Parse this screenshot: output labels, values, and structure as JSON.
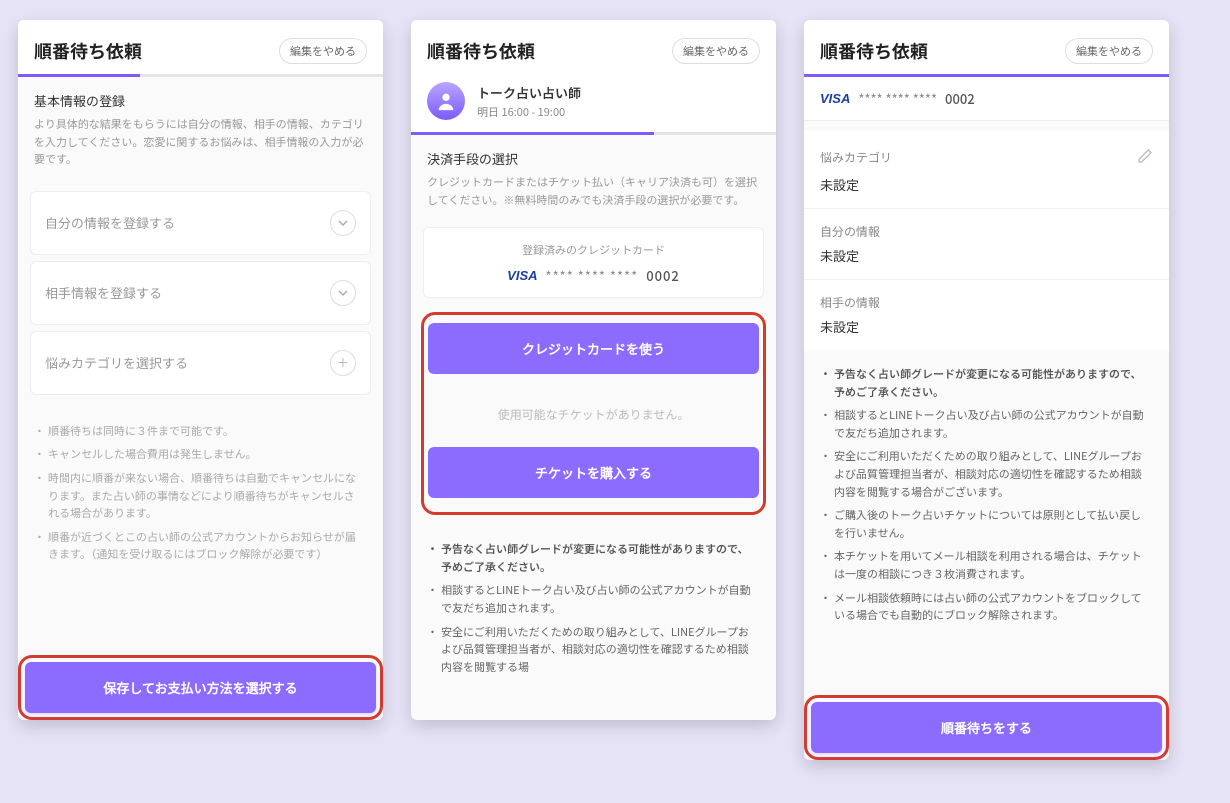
{
  "header": {
    "title": "順番待ち依頼",
    "cancel": "編集をやめる"
  },
  "screen1": {
    "section_title": "基本情報の登録",
    "section_desc": "より具体的な結果をもらうには自分の情報、相手の情報、カテゴリを入力してください。恋愛に関するお悩みは、相手情報の入力が必要です。",
    "card_self": "自分の情報を登録する",
    "card_partner": "相手情報を登録する",
    "card_category": "悩みカテゴリを選択する",
    "notes": [
      "順番待ちは同時に３件まで可能です。",
      "キャンセルした場合費用は発生しません。",
      "時間内に順番が来ない場合、順番待ちは自動でキャンセルになります。また占い師の事情などにより順番待ちがキャンセルされる場合があります。",
      "順番が近づくとこの占い師の公式アカウントからお知らせが届きます。（通知を受け取るにはブロック解除が必要です）"
    ],
    "cta": "保存してお支払い方法を選択する"
  },
  "screen2": {
    "teller_name": "トーク占い占い師",
    "teller_time": "明日 16:00 - 19:00",
    "section_title": "決済手段の選択",
    "section_desc": "クレジットカードまたはチケット払い（キャリア決済も可）を選択してください。※無料時間のみでも決済手段の選択が必要です。",
    "registered_label": "登録済みのクレジットカード",
    "card_brand": "VISA",
    "card_mask": "**** **** ****",
    "card_last": "0002",
    "btn_use_card": "クレジットカードを使う",
    "no_ticket": "使用可能なチケットがありません。",
    "btn_buy_ticket": "チケットを購入する",
    "notes": [
      "予告なく占い師グレードが変更になる可能性がありますので、予めご了承ください。",
      "相談するとLINEトーク占い及び占い師の公式アカウントが自動で友だち追加されます。",
      "安全にご利用いただくための取り組みとして、LINEグループおよび品質管理担当者が、相談対応の適切性を確認するため相談内容を閲覧する場"
    ]
  },
  "screen3": {
    "card_brand": "VISA",
    "card_mask": "**** **** ****",
    "card_last": "0002",
    "cat_label": "悩みカテゴリ",
    "cat_val": "未設定",
    "self_label": "自分の情報",
    "self_val": "未設定",
    "partner_label": "相手の情報",
    "partner_val": "未設定",
    "notes": [
      "予告なく占い師グレードが変更になる可能性がありますので、予めご了承ください。",
      "相談するとLINEトーク占い及び占い師の公式アカウントが自動で友だち追加されます。",
      "安全にご利用いただくための取り組みとして、LINEグループおよび品質管理担当者が、相談対応の適切性を確認するため相談内容を閲覧する場合がございます。",
      "ご購入後のトーク占いチケットについては原則として払い戻しを行いません。",
      "本チケットを用いてメール相談を利用される場合は、チケットは一度の相談につき３枚消費されます。",
      "メール相談依頼時には占い師の公式アカウントをブロックしている場合でも自動的にブロック解除されます。"
    ],
    "cta": "順番待ちをする"
  }
}
